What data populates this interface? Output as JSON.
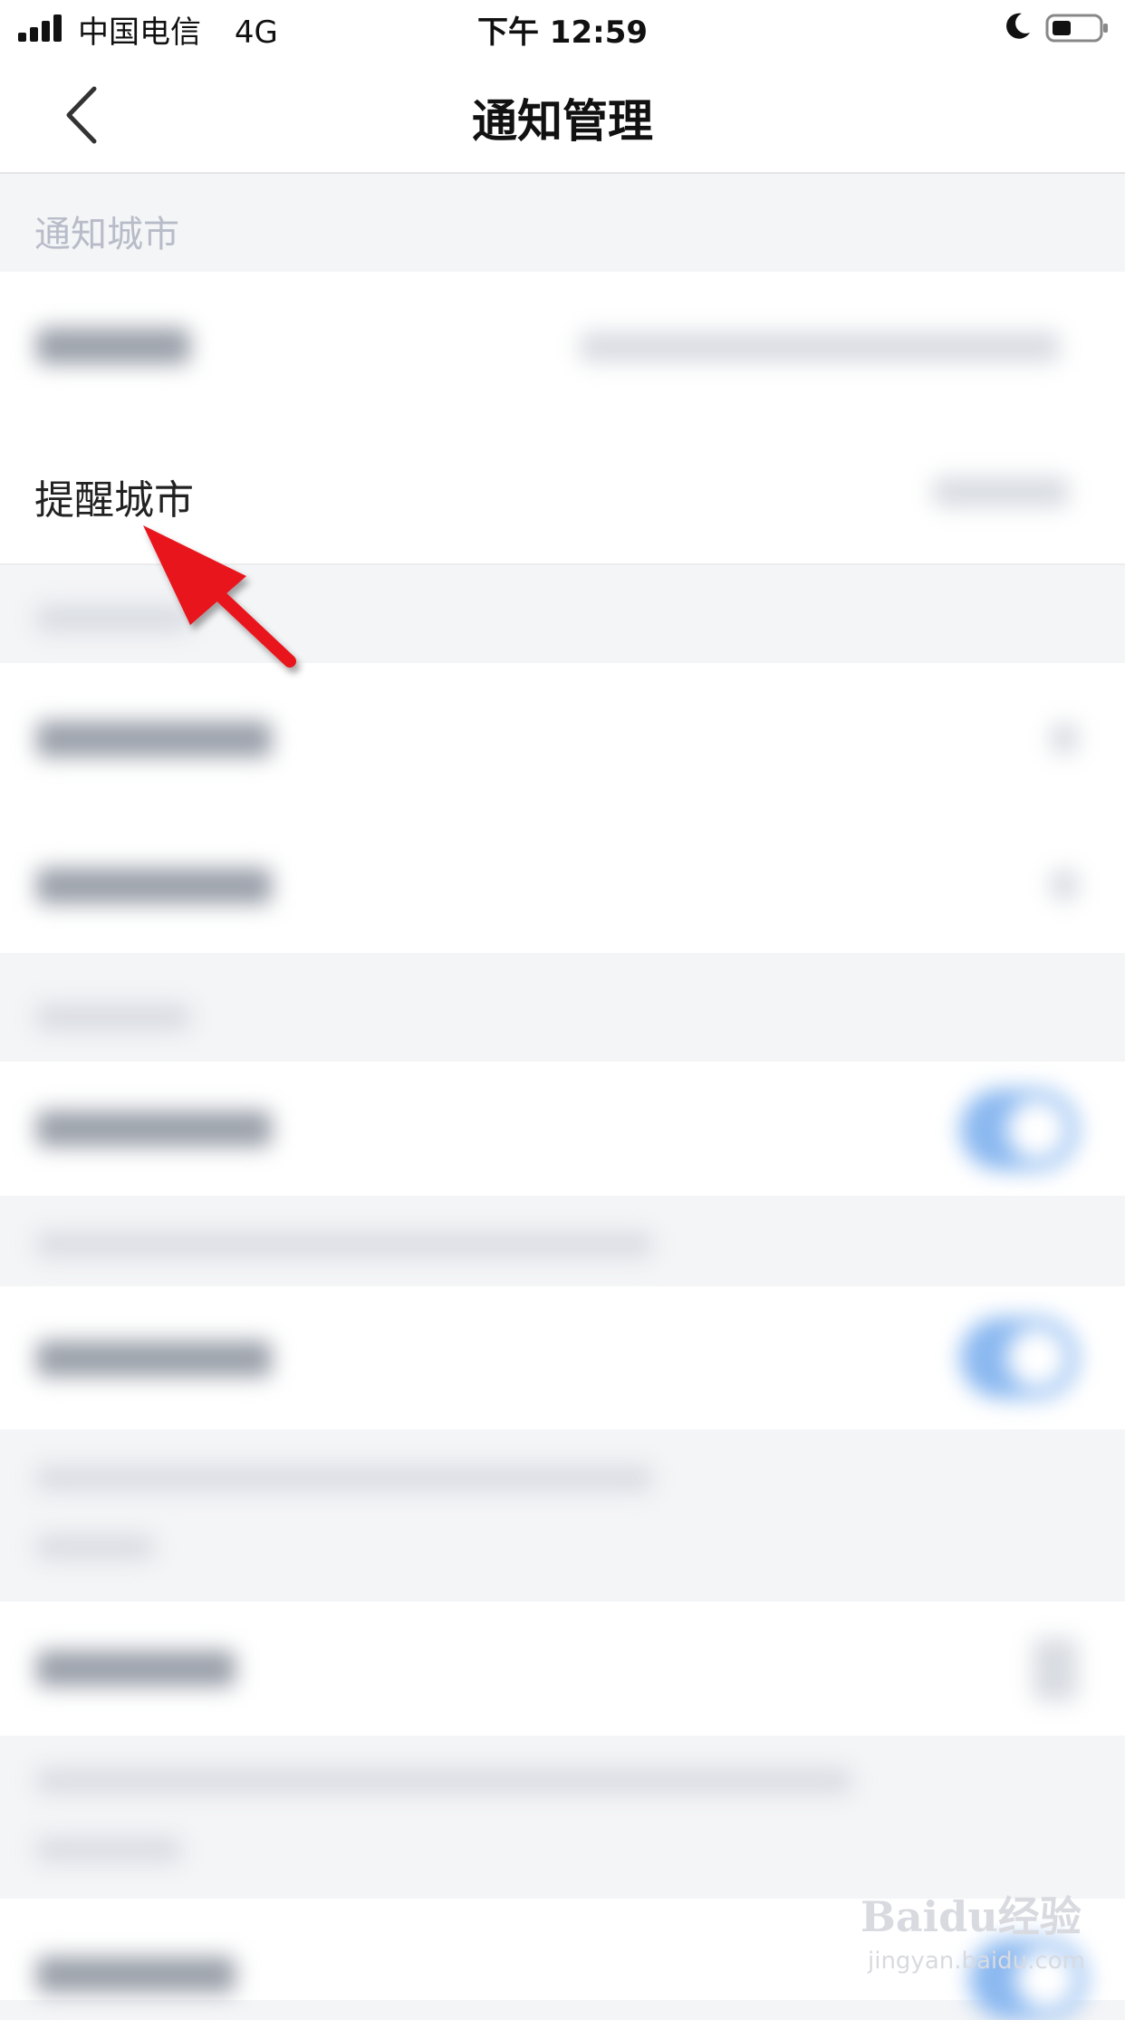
{
  "status_bar": {
    "carrier": "中国电信",
    "network": "4G",
    "time": "下午 12:59"
  },
  "nav": {
    "title": "通知管理"
  },
  "sections": {
    "notify_city_header": "通知城市",
    "remind_city_label": "提醒城市"
  },
  "watermark": {
    "main": "Baidu经验",
    "sub": "jingyan.baidu.com"
  },
  "colors": {
    "accent_toggle": "#8ab8f0",
    "arrow": "#e8131b",
    "background": "#f4f5f7"
  }
}
